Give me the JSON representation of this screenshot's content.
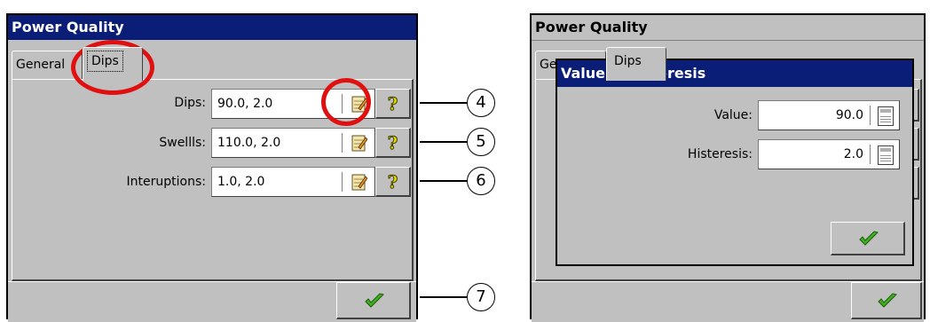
{
  "left_window": {
    "title": "Power Quality",
    "tabs": [
      {
        "label": "General"
      },
      {
        "label": "Dips"
      }
    ],
    "rows": [
      {
        "label": "Dips:",
        "value": "90.0, 2.0"
      },
      {
        "label": "Swellls:",
        "value": "110.0, 2.0"
      },
      {
        "label": "Interuptions:",
        "value": "1.0, 2.0"
      }
    ],
    "help_glyph": "?"
  },
  "callouts": [
    "4",
    "5",
    "6",
    "7"
  ],
  "right_window": {
    "title": "Power Quality",
    "tabs": [
      {
        "label": "General"
      },
      {
        "label": "Dips"
      }
    ]
  },
  "dialog": {
    "title": "Value & histeresis",
    "value_label": "Value:",
    "value": "90.0",
    "histeresis_label": "Histeresis:",
    "histeresis": "2.0"
  },
  "colors": {
    "title_bar": "#0a1e78",
    "check": "#2a8a12",
    "annotation_ring": "#e01010"
  },
  "icons": {
    "edit": "notepad-edit-icon",
    "help": "question-mark-icon",
    "ok": "check-mark-icon",
    "calculator": "calculator-icon"
  }
}
